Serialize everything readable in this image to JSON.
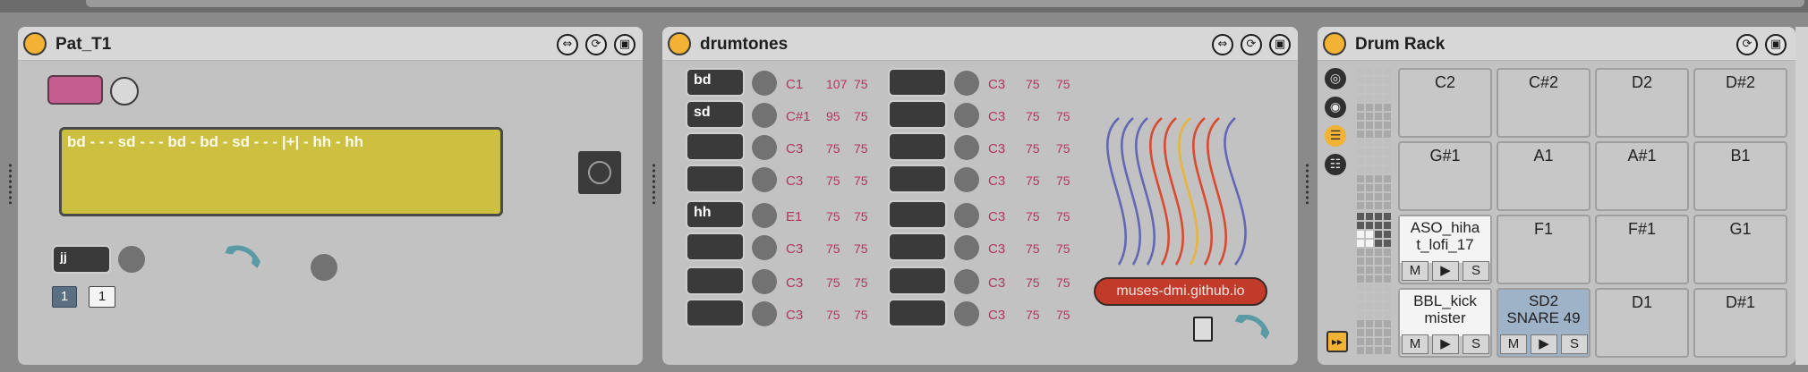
{
  "pat_device": {
    "title": "Pat_T1",
    "pattern_text": "bd - - - sd - - - bd - bd - sd - - - |+| - hh - hh",
    "jj_label": "jj",
    "counter_a": "1",
    "counter_b": "1"
  },
  "drumtones": {
    "title": "drumtones",
    "left_rows": [
      {
        "name": "bd",
        "note": "C1",
        "v1": "107",
        "v2": "75"
      },
      {
        "name": "sd",
        "note": "C#1",
        "v1": "95",
        "v2": "75"
      },
      {
        "name": "",
        "note": "C3",
        "v1": "75",
        "v2": "75"
      },
      {
        "name": "",
        "note": "C3",
        "v1": "75",
        "v2": "75"
      },
      {
        "name": "hh",
        "note": "E1",
        "v1": "75",
        "v2": "75"
      },
      {
        "name": "",
        "note": "C3",
        "v1": "75",
        "v2": "75"
      },
      {
        "name": "",
        "note": "C3",
        "v1": "75",
        "v2": "75"
      },
      {
        "name": "",
        "note": "C3",
        "v1": "75",
        "v2": "75"
      }
    ],
    "right_rows": [
      {
        "note": "C3",
        "v1": "75",
        "v2": "75"
      },
      {
        "note": "C3",
        "v1": "75",
        "v2": "75"
      },
      {
        "note": "C3",
        "v1": "75",
        "v2": "75"
      },
      {
        "note": "C3",
        "v1": "75",
        "v2": "75"
      },
      {
        "note": "C3",
        "v1": "75",
        "v2": "75"
      },
      {
        "note": "C3",
        "v1": "75",
        "v2": "75"
      },
      {
        "note": "C3",
        "v1": "75",
        "v2": "75"
      },
      {
        "note": "C3",
        "v1": "75",
        "v2": "75"
      }
    ],
    "link_text": "muses-dmi.github.io"
  },
  "drum_rack": {
    "title": "Drum Rack",
    "pads": [
      {
        "label": "C2"
      },
      {
        "label": "C#2"
      },
      {
        "label": "D2"
      },
      {
        "label": "D#2"
      },
      {
        "label": "G#1"
      },
      {
        "label": "A1"
      },
      {
        "label": "A#1"
      },
      {
        "label": "B1"
      },
      {
        "label": "ASO_hihat_lofi_17",
        "line1": "ASO_hiha",
        "line2": "t_lofi_17",
        "loaded": true
      },
      {
        "label": "F1"
      },
      {
        "label": "F#1"
      },
      {
        "label": "G1"
      },
      {
        "label": "BBL_kick mister",
        "line1": "BBL_kick",
        "line2": "mister",
        "loaded": true
      },
      {
        "label": "SD2 SNARE 49",
        "line1": "SD2",
        "line2": "SNARE 49",
        "loaded": true,
        "selected": true
      },
      {
        "label": "D1"
      },
      {
        "label": "D#1"
      }
    ],
    "mute": "M",
    "play": "▶",
    "solo": "S"
  },
  "colors": {
    "power": "#f2b233",
    "pattern_bg": "#cdbf3f",
    "pink": "#c45e90",
    "note_text": "#b2355c",
    "link_bg": "#c23a2a",
    "pad_selected": "#9fb3c8"
  }
}
